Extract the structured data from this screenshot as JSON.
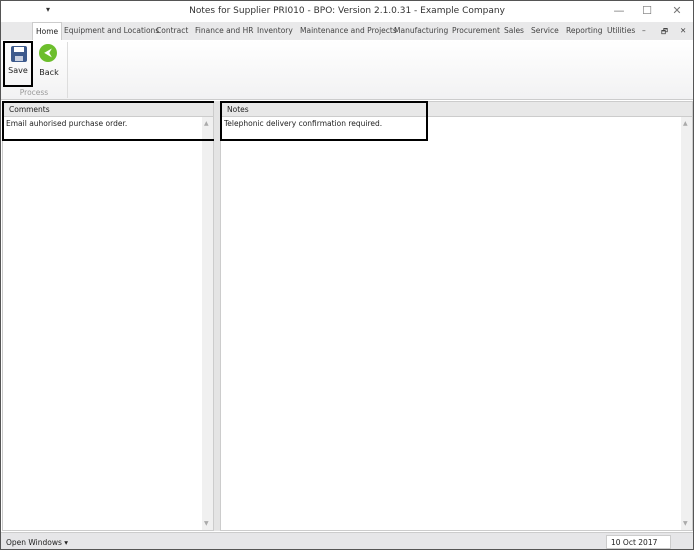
{
  "window": {
    "title": "Notes for Supplier PRI010 - BPO: Version 2.1.0.31 - Example Company",
    "quick_access": "▾",
    "minimize": "—",
    "maximize": "☐",
    "close": "✕"
  },
  "tabs": [
    {
      "label": "Home"
    },
    {
      "label": "Equipment and Locations"
    },
    {
      "label": "Contract"
    },
    {
      "label": "Finance and HR"
    },
    {
      "label": "Inventory"
    },
    {
      "label": "Maintenance and Projects"
    },
    {
      "label": "Manufacturing"
    },
    {
      "label": "Procurement"
    },
    {
      "label": "Sales"
    },
    {
      "label": "Service"
    },
    {
      "label": "Reporting"
    },
    {
      "label": "Utilities"
    }
  ],
  "mdi": {
    "minimize": "–",
    "restore": "🗗",
    "close": "✕"
  },
  "ribbon": {
    "save": "Save",
    "back": "Back",
    "group": "Process"
  },
  "comments": {
    "header": "Comments",
    "text": "Email auhorised purchase order."
  },
  "notes": {
    "header": "Notes",
    "text": "Telephonic delivery confirmation required."
  },
  "status": {
    "open_windows": "Open Windows ▾",
    "date": "10 Oct 2017"
  }
}
